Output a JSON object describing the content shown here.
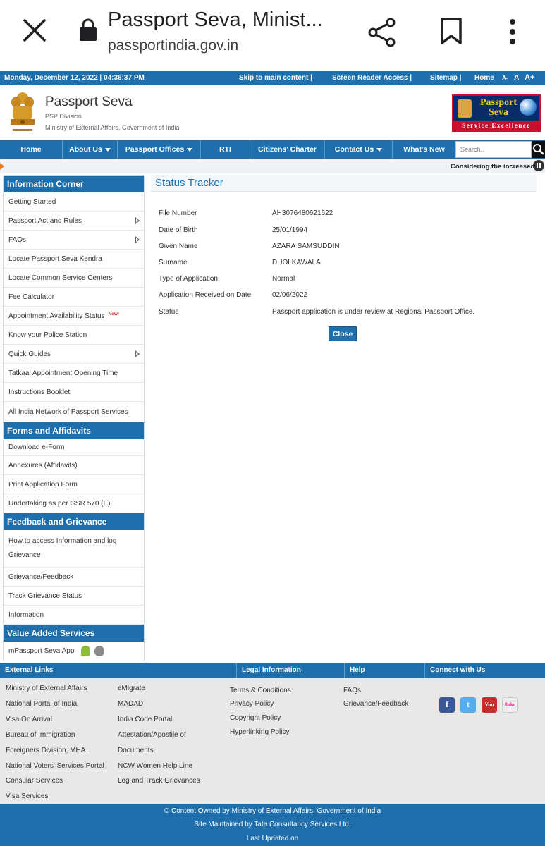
{
  "browser": {
    "title": "Passport Seva, Minist...",
    "url": "passportindia.gov.in"
  },
  "topstrip": {
    "datetime": "Monday, December 12, 2022 | 04:36:37 PM",
    "skip": "Skip to main content  |",
    "screen_reader": "Screen Reader Access  |",
    "sitemap": "Sitemap  |",
    "home": "Home",
    "font_small": "A-",
    "font_normal": "A",
    "font_large": "A+"
  },
  "header": {
    "title": "Passport Seva",
    "division": "PSP Division",
    "ministry": "Ministry of External Affairs, Government of India",
    "logo_line1": "Passport",
    "logo_line2": "Seva",
    "logo_tagline": "Service Excellence"
  },
  "nav": {
    "items": [
      "Home",
      "About Us",
      "Passport Offices",
      "RTI",
      "Citizens' Charter",
      "Contact Us",
      "What's New"
    ],
    "search_placeholder": "Search.."
  },
  "ticker": {
    "text": "Considering the increased"
  },
  "sidebar": {
    "info_corner": "Information Corner",
    "info_items": [
      "Getting Started",
      "Passport Act and Rules",
      "FAQs",
      "Locate Passport Seva Kendra",
      "Locate Common Service Centers",
      "Fee Calculator",
      "Appointment Availability Status",
      "Know your Police Station",
      "Quick Guides",
      "Tatkaal Appointment Opening Time",
      "Instructions Booklet",
      "All India Network of Passport Services"
    ],
    "new_badge": "New!",
    "forms_title": "Forms and Affidavits",
    "forms_items": [
      "Download e-Form",
      "Annexures (Affidavits)",
      "Print Application Form",
      "Undertaking as per GSR 570 (E)"
    ],
    "feedback_title": "Feedback and Grievance",
    "feedback_items": [
      "How to access Information and log Grievance",
      "Grievance/Feedback",
      "Track Grievance Status",
      "Information"
    ],
    "vas_title": "Value Added Services",
    "vas_item": "mPassport Seva App"
  },
  "main": {
    "title": "Status Tracker",
    "rows": [
      {
        "label": "File Number",
        "value": "AH3076480621622"
      },
      {
        "label": "Date of Birth",
        "value": "25/01/1994"
      },
      {
        "label": "Given Name",
        "value": "AZARA SAMSUDDIN"
      },
      {
        "label": "Surname",
        "value": "DHOLKAWALA"
      },
      {
        "label": "Type of Application",
        "value": "Normal"
      },
      {
        "label": "Application Received on Date",
        "value": "02/06/2022"
      },
      {
        "label": "Status",
        "value": "Passport application is under review at Regional Passport Office."
      }
    ],
    "close_label": "Close"
  },
  "footer": {
    "external_links": "External Links",
    "legal_info": "Legal Information",
    "help": "Help",
    "connect": "Connect with Us",
    "ext_col1": [
      "Ministry of External Affairs",
      "National Portal of India",
      "Visa On Arrival",
      "Bureau of Immigration",
      "Foreigners Division, MHA",
      "National Voters' Services Portal",
      "Consular Services",
      "Visa Services"
    ],
    "ext_col2": [
      "eMigrate",
      "MADAD",
      "India Code Portal",
      "Attestation/Apostile of",
      "Documents",
      "NCW Women Help Line",
      "Log and Track Grievances"
    ],
    "legal_items": [
      "Terms & Conditions",
      "Privacy Policy",
      "Copyright Policy",
      "Hyperlinking Policy"
    ],
    "help_items": [
      "FAQs",
      "Grievance/Feedback"
    ],
    "social": {
      "facebook": "f",
      "twitter": "t",
      "youtube": "You",
      "flickr": "flickr"
    },
    "owned": "© Content Owned by Ministry of External Affairs, Government of India",
    "maintained": "Site Maintained by Tata Consultancy Services Ltd.",
    "updated": "Last Updated on"
  },
  "colors": {
    "primary": "#1f6fad",
    "logo_red": "#c8102e",
    "logo_navy": "#0a2c6a"
  }
}
